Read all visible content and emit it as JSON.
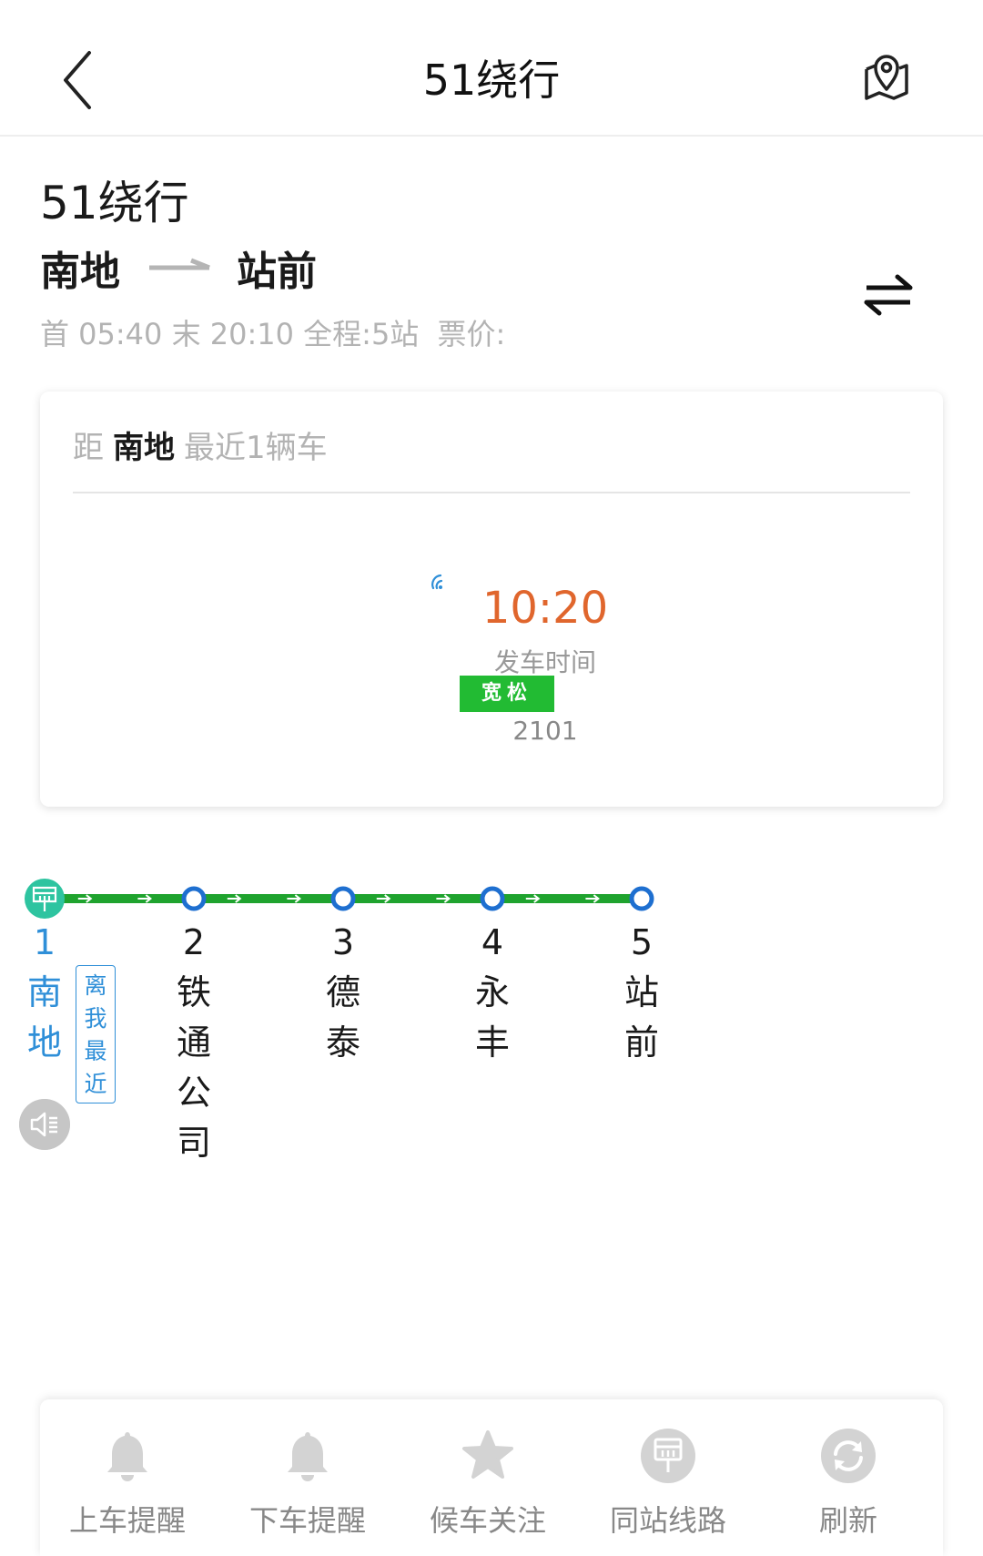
{
  "header": {
    "title": "51绕行",
    "back_icon": "chevron-left-icon",
    "map_icon": "map-location-icon"
  },
  "route": {
    "name": "51绕行",
    "from": "南地",
    "to": "站前",
    "first_bus": "首 05:40",
    "last_bus": "末 20:10",
    "total": "全程:5站",
    "fare": "票价:",
    "swap_icon": "swap-direction-icon"
  },
  "arrival_card": {
    "prefix": "距",
    "station": "南地",
    "suffix": "最近1辆车",
    "signal_icon": "live-signal-icon",
    "time": "10:20",
    "time_label": "发车时间",
    "crowd": "宽松",
    "bus_number": "2101"
  },
  "stations": [
    {
      "index": "1",
      "name": [
        "南",
        "地"
      ],
      "current": true
    },
    {
      "index": "2",
      "name": [
        "铁",
        "通",
        "公",
        "司"
      ],
      "current": false
    },
    {
      "index": "3",
      "name": [
        "德",
        "泰"
      ],
      "current": false
    },
    {
      "index": "4",
      "name": [
        "永",
        "丰"
      ],
      "current": false
    },
    {
      "index": "5",
      "name": [
        "站",
        "前"
      ],
      "current": false
    }
  ],
  "near_tag": [
    "离",
    "我",
    "最",
    "近"
  ],
  "voice_icon": "speaker-icon",
  "bottom_bar": [
    {
      "label": "上车提醒",
      "icon": "bell-icon"
    },
    {
      "label": "下车提醒",
      "icon": "bell-icon"
    },
    {
      "label": "候车关注",
      "icon": "star-icon"
    },
    {
      "label": "同站线路",
      "icon": "bus-stop-icon"
    },
    {
      "label": "刷新",
      "icon": "refresh-icon"
    }
  ],
  "colors": {
    "line_green": "#1fa32e",
    "station_blue": "#1e6fd0",
    "current_blue": "#2f8fd8",
    "time_orange": "#e0662d",
    "crowd_green": "#22bb33"
  }
}
